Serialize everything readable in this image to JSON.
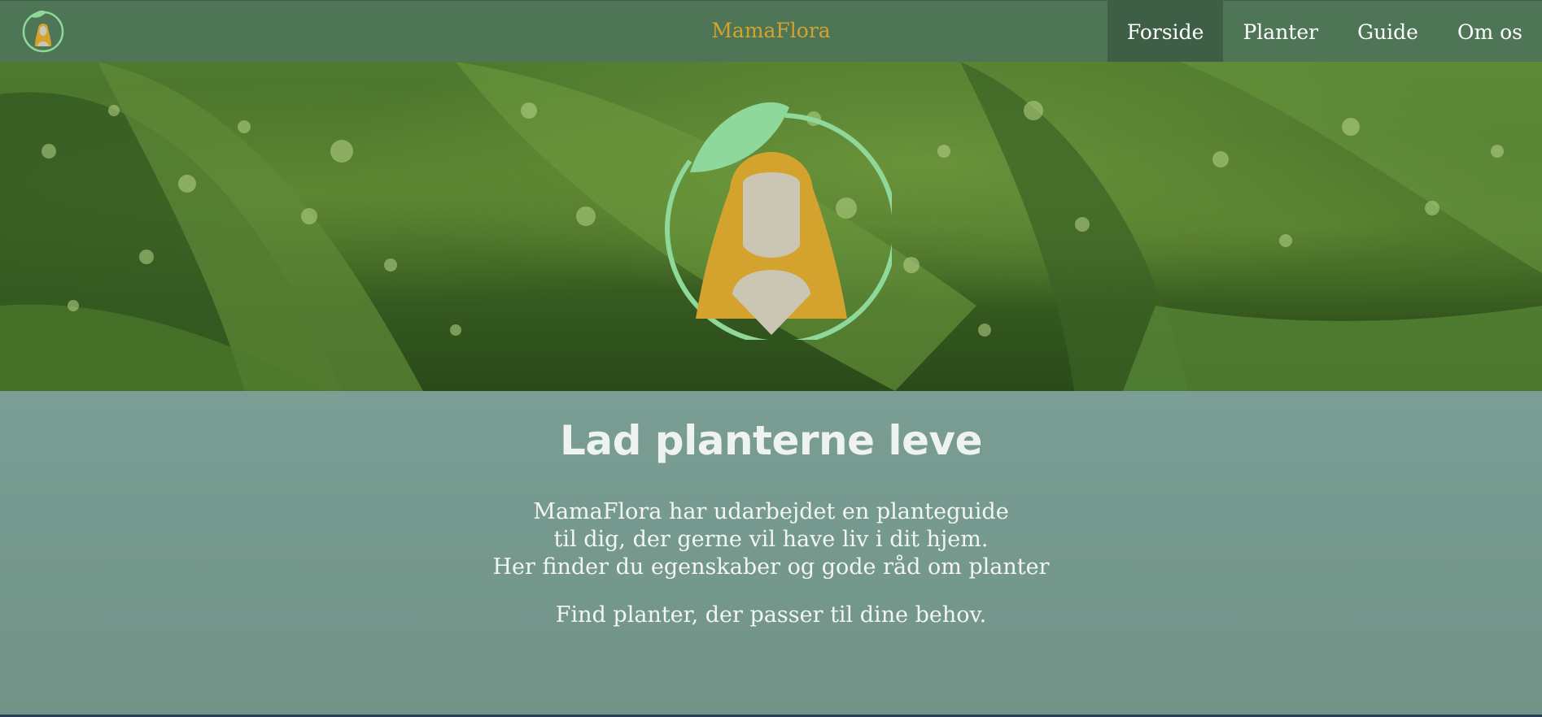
{
  "header": {
    "brand": "MamaFlora",
    "logo_icon": "mamaflora-logo-icon",
    "nav": [
      {
        "label": "Forside",
        "active": true
      },
      {
        "label": "Planter",
        "active": false
      },
      {
        "label": "Guide",
        "active": false
      },
      {
        "label": "Om os",
        "active": false
      }
    ]
  },
  "hero": {
    "background": "wet-green-leaves-image",
    "logo_icon": "mamaflora-logo-icon"
  },
  "main": {
    "title": "Lad planterne leve",
    "intro_lines": [
      "MamaFlora har udarbejdet en planteguide",
      "til dig, der gerne vil have liv i dit hjem.",
      "Her finder du egenskaber og gode råd om planter"
    ],
    "cta": "Find planter, der passer til dine behov."
  },
  "colors": {
    "navbar": "#4e7656",
    "nav_active": "#3e5f46",
    "brand": "#d4a32e",
    "logo_ring": "#8fd89b",
    "logo_hair": "#d4a32e",
    "logo_face": "#cbc6b4",
    "content_bg": "#7a9e94"
  }
}
